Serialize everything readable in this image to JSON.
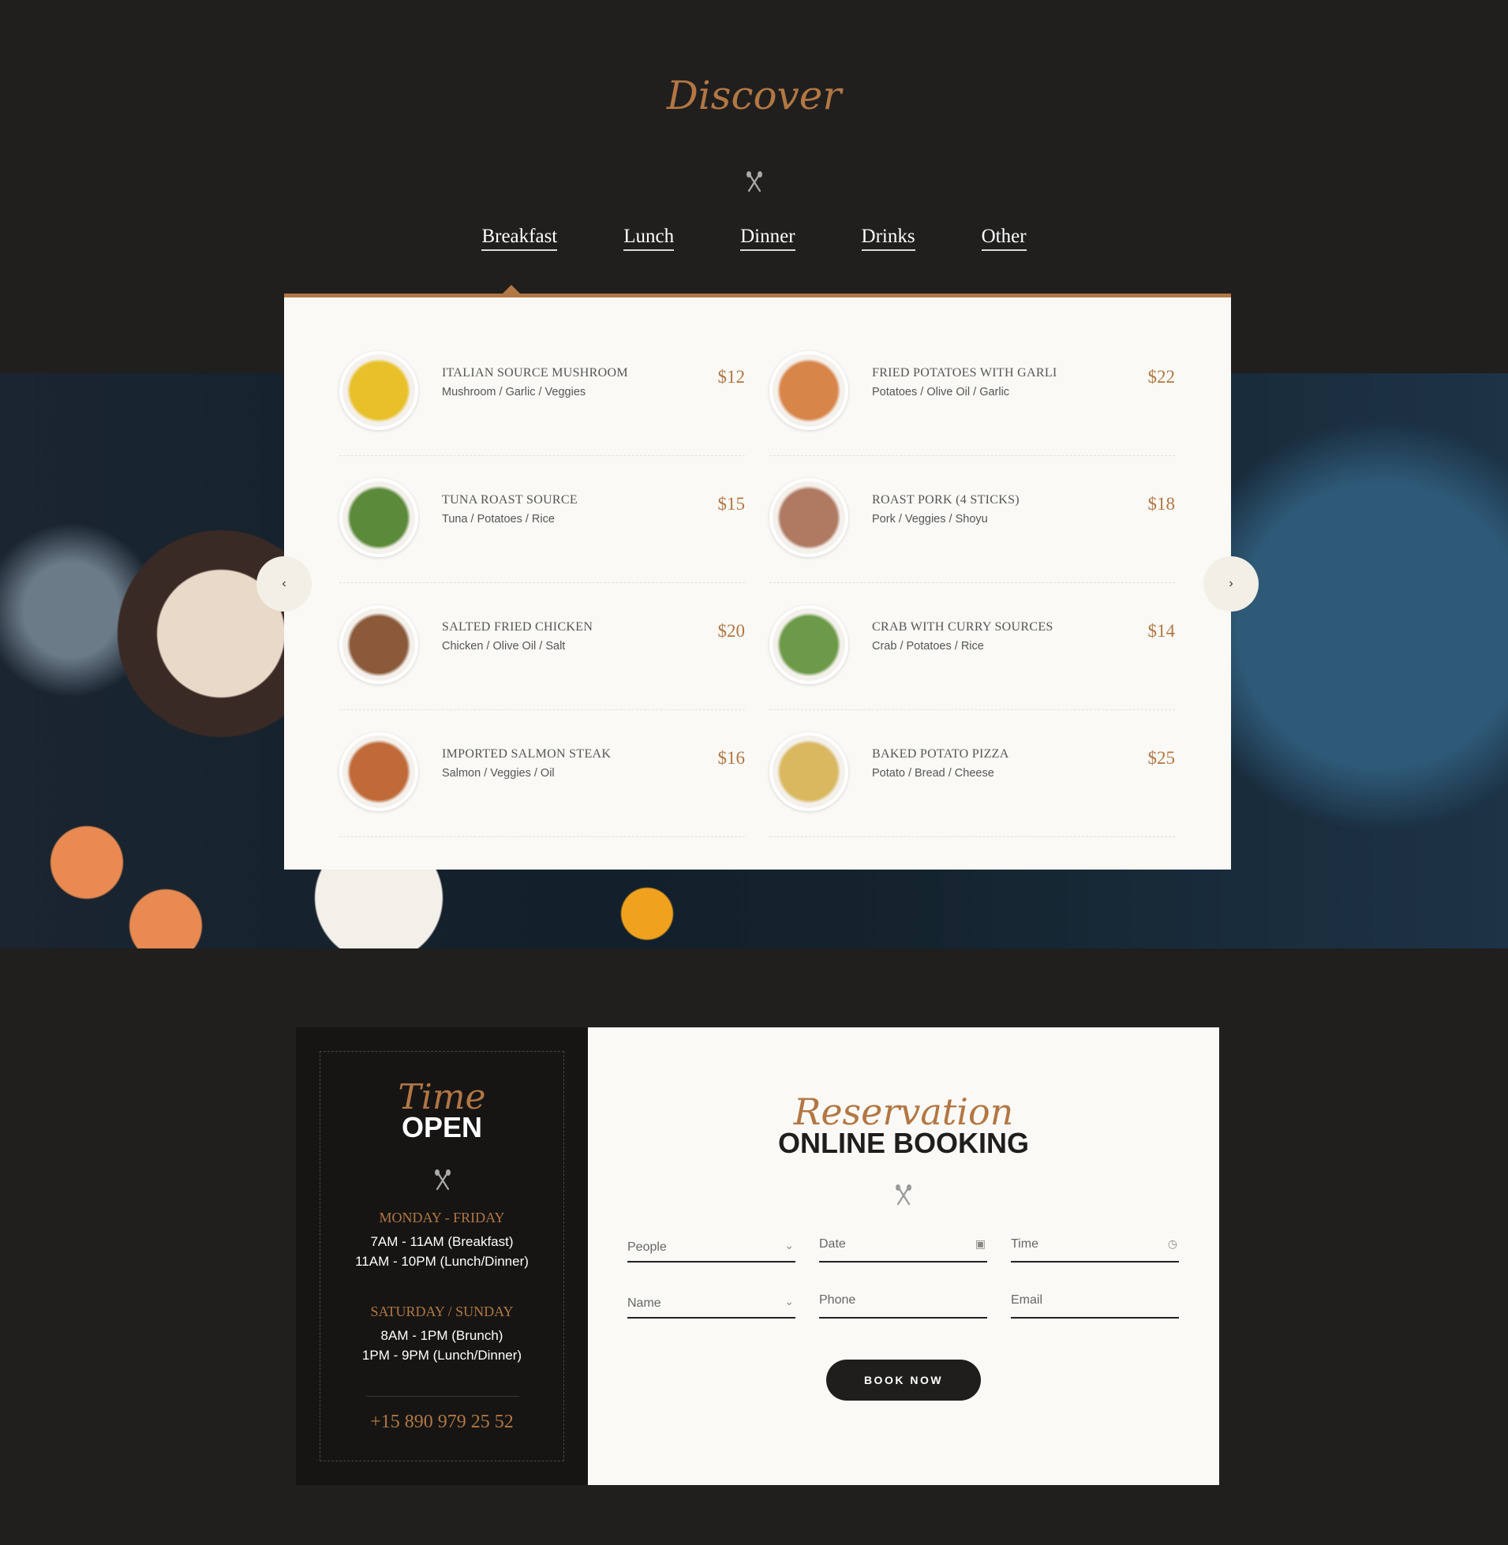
{
  "header": {
    "title": "Discover"
  },
  "tabs": [
    {
      "label": "Breakfast",
      "active": true
    },
    {
      "label": "Lunch"
    },
    {
      "label": "Dinner"
    },
    {
      "label": "Drinks"
    },
    {
      "label": "Other"
    }
  ],
  "colors": {
    "accent": "#b27744",
    "background": "#201f1e",
    "card": "#faf9f5"
  },
  "menu": [
    {
      "name": "ITALIAN SOURCE MUSHROOM",
      "ingredients": "Mushroom / Garlic / Veggies",
      "price": "$12"
    },
    {
      "name": "FRIED POTATOES WITH GARLI",
      "ingredients": "Potatoes / Olive Oil / Garlic",
      "price": "$22"
    },
    {
      "name": "TUNA ROAST SOURCE",
      "ingredients": "Tuna / Potatoes / Rice",
      "price": "$15"
    },
    {
      "name": "ROAST PORK (4 STICKS)",
      "ingredients": "Pork / Veggies / Shoyu",
      "price": "$18"
    },
    {
      "name": "SALTED FRIED CHICKEN",
      "ingredients": "Chicken / Olive Oil / Salt",
      "price": "$20"
    },
    {
      "name": "CRAB WITH CURRY SOURCES",
      "ingredients": "Crab / Potatoes / Rice",
      "price": "$14"
    },
    {
      "name": "IMPORTED SALMON STEAK",
      "ingredients": "Salmon / Veggies / Oil",
      "price": "$16"
    },
    {
      "name": "BAKED POTATO PIZZA",
      "ingredients": "Potato / Bread / Cheese",
      "price": "$25"
    }
  ],
  "carousel": {
    "prev": "‹",
    "next": "›"
  },
  "hours": {
    "script": "Time",
    "title": "OPEN",
    "weekday_label": "MONDAY - FRIDAY",
    "weekday_lines": [
      "7AM - 11AM (Breakfast)",
      "11AM - 10PM (Lunch/Dinner)"
    ],
    "weekend_label": "SATURDAY / SUNDAY",
    "weekend_lines": [
      "8AM - 1PM (Brunch)",
      "1PM - 9PM (Lunch/Dinner)"
    ],
    "phone": "+15 890 979 25 52"
  },
  "booking": {
    "script": "Reservation",
    "title": "ONLINE BOOKING",
    "fields": {
      "people": "People",
      "date": "Date",
      "time": "Time",
      "name": "Name",
      "phone": "Phone",
      "email": "Email"
    },
    "button": "BOOK NOW"
  }
}
